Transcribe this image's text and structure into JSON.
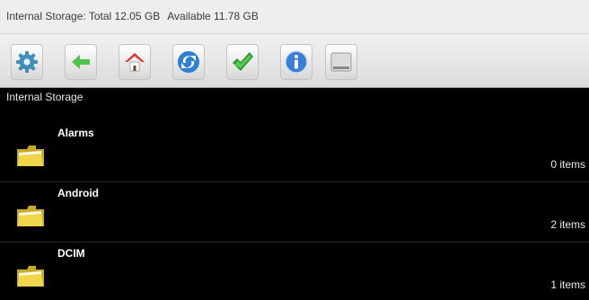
{
  "status": {
    "total_text": "Internal Storage: Total 12.05 GB",
    "available_text": "Available 11.78 GB"
  },
  "toolbar": {
    "buttons": [
      {
        "icon": "settings-gear-icon"
      },
      {
        "icon": "back-arrow-icon"
      },
      {
        "icon": "home-icon"
      },
      {
        "icon": "refresh-icon"
      },
      {
        "icon": "check-icon"
      },
      {
        "icon": "info-icon"
      },
      {
        "icon": "storage-drive-icon"
      }
    ]
  },
  "current_path": "Internal Storage",
  "files": [
    {
      "name": "Alarms",
      "count": "0 items",
      "icon": "folder-icon"
    },
    {
      "name": "Android",
      "count": "2 items",
      "icon": "folder-icon"
    },
    {
      "name": "DCIM",
      "count": "1 items",
      "icon": "folder-icon"
    }
  ],
  "colors": {
    "background": "#000000",
    "toolbar": "#e3e3e3",
    "folder": "#f0d64a"
  }
}
